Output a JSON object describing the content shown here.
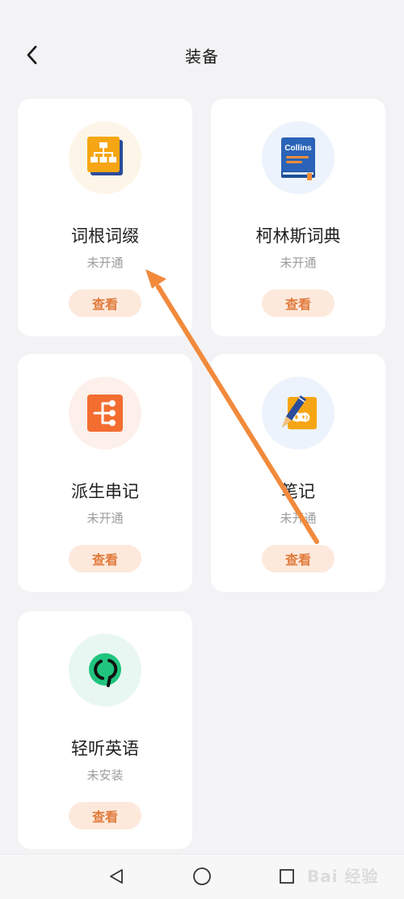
{
  "header": {
    "title": "装备"
  },
  "cards": [
    {
      "title": "词根词缀",
      "status": "未开通",
      "button": "查看",
      "icon": "hierarchy-icon",
      "icon_bg": "#fdf6e8"
    },
    {
      "title": "柯林斯词典",
      "status": "未开通",
      "button": "查看",
      "icon": "collins-book-icon",
      "icon_text": "Collins",
      "icon_bg": "#edf3fc"
    },
    {
      "title": "派生串记",
      "status": "未开通",
      "button": "查看",
      "icon": "branch-icon",
      "icon_bg": "#fdf0ea"
    },
    {
      "title": "笔记",
      "status": "未开通",
      "button": "查看",
      "icon": "note-pen-icon",
      "icon_bg": "#edf3fc"
    },
    {
      "title": "轻听英语",
      "status": "未安装",
      "button": "查看",
      "icon": "listen-ring-icon",
      "icon_bg": "#e8f7f1"
    }
  ],
  "colors": {
    "accent": "#e07a3a",
    "button_bg": "#fde9dc",
    "annotation_arrow": "#f28a3c"
  },
  "watermark": {
    "text": "Bai 经验"
  }
}
